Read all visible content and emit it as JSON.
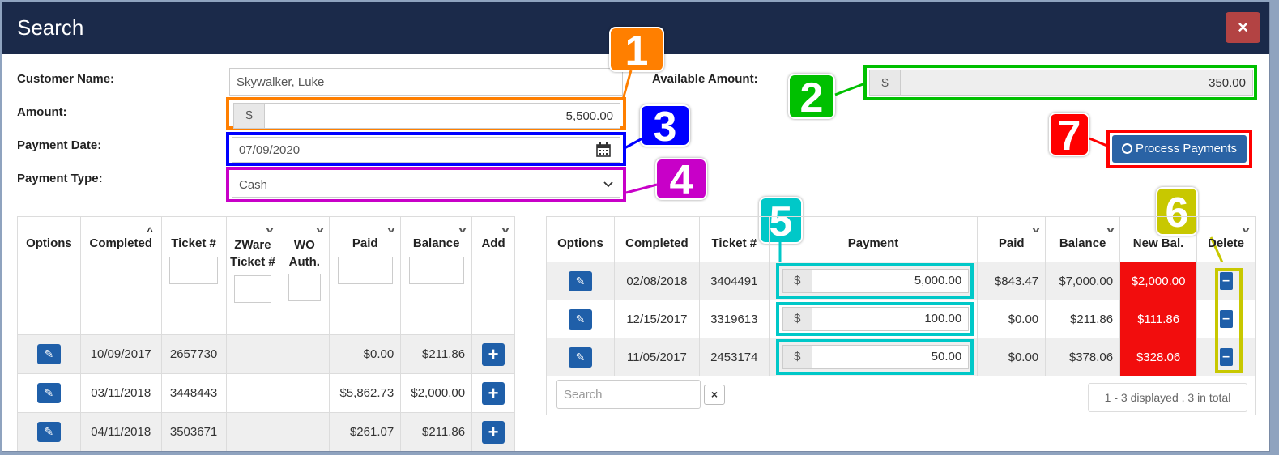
{
  "header": {
    "title": "Search",
    "close_label": "×"
  },
  "form": {
    "customer_label": "Customer Name:",
    "customer_value": "Skywalker, Luke",
    "amount_label": "Amount:",
    "amount_prefix": "$",
    "amount_value": "5,500.00",
    "date_label": "Payment Date:",
    "date_value": "07/09/2020",
    "type_label": "Payment Type:",
    "type_value": "Cash",
    "available_label": "Available Amount:",
    "available_prefix": "$",
    "available_value": "350.00"
  },
  "process_button": "Process Payments",
  "badges": [
    "1",
    "2",
    "3",
    "4",
    "5",
    "6",
    "7"
  ],
  "left_table": {
    "headers": [
      "Options",
      "Completed",
      "Ticket #",
      "ZWare Ticket #",
      "WO Auth.",
      "Paid",
      "Balance",
      "Add"
    ],
    "rows": [
      {
        "completed": "10/09/2017",
        "ticket": "2657730",
        "paid": "$0.00",
        "balance": "$211.86"
      },
      {
        "completed": "03/11/2018",
        "ticket": "3448443",
        "paid": "$5,862.73",
        "balance": "$2,000.00"
      },
      {
        "completed": "04/11/2018",
        "ticket": "3503671",
        "paid": "$261.07",
        "balance": "$211.86"
      }
    ]
  },
  "right_table": {
    "headers": [
      "Options",
      "Completed",
      "Ticket #",
      "Payment",
      "Paid",
      "Balance",
      "New Bal.",
      "Delete"
    ],
    "rows": [
      {
        "completed": "02/08/2018",
        "ticket": "3404491",
        "prefix": "$",
        "payment": "5,000.00",
        "paid": "$843.47",
        "balance": "$7,000.00",
        "new_bal": "$2,000.00"
      },
      {
        "completed": "12/15/2017",
        "ticket": "3319613",
        "prefix": "$",
        "payment": "100.00",
        "paid": "$0.00",
        "balance": "$211.86",
        "new_bal": "$111.86"
      },
      {
        "completed": "11/05/2017",
        "ticket": "2453174",
        "prefix": "$",
        "payment": "50.00",
        "paid": "$0.00",
        "balance": "$378.06",
        "new_bal": "$328.06"
      }
    ]
  },
  "search": {
    "placeholder": "Search",
    "clear_label": "×"
  },
  "pager": "1 - 3 displayed , 3 in total",
  "colors": {
    "header": "#1b2a4a",
    "close": "#b34343",
    "badge1": "#ff7f00",
    "badge2": "#00c000",
    "badge3": "#0000ff",
    "badge4": "#c800c8",
    "badge5": "#00c8c8",
    "badge6": "#c8c800",
    "badge7": "#ff0000",
    "button": "#1f5fa9",
    "negative": "#f20d0d"
  }
}
